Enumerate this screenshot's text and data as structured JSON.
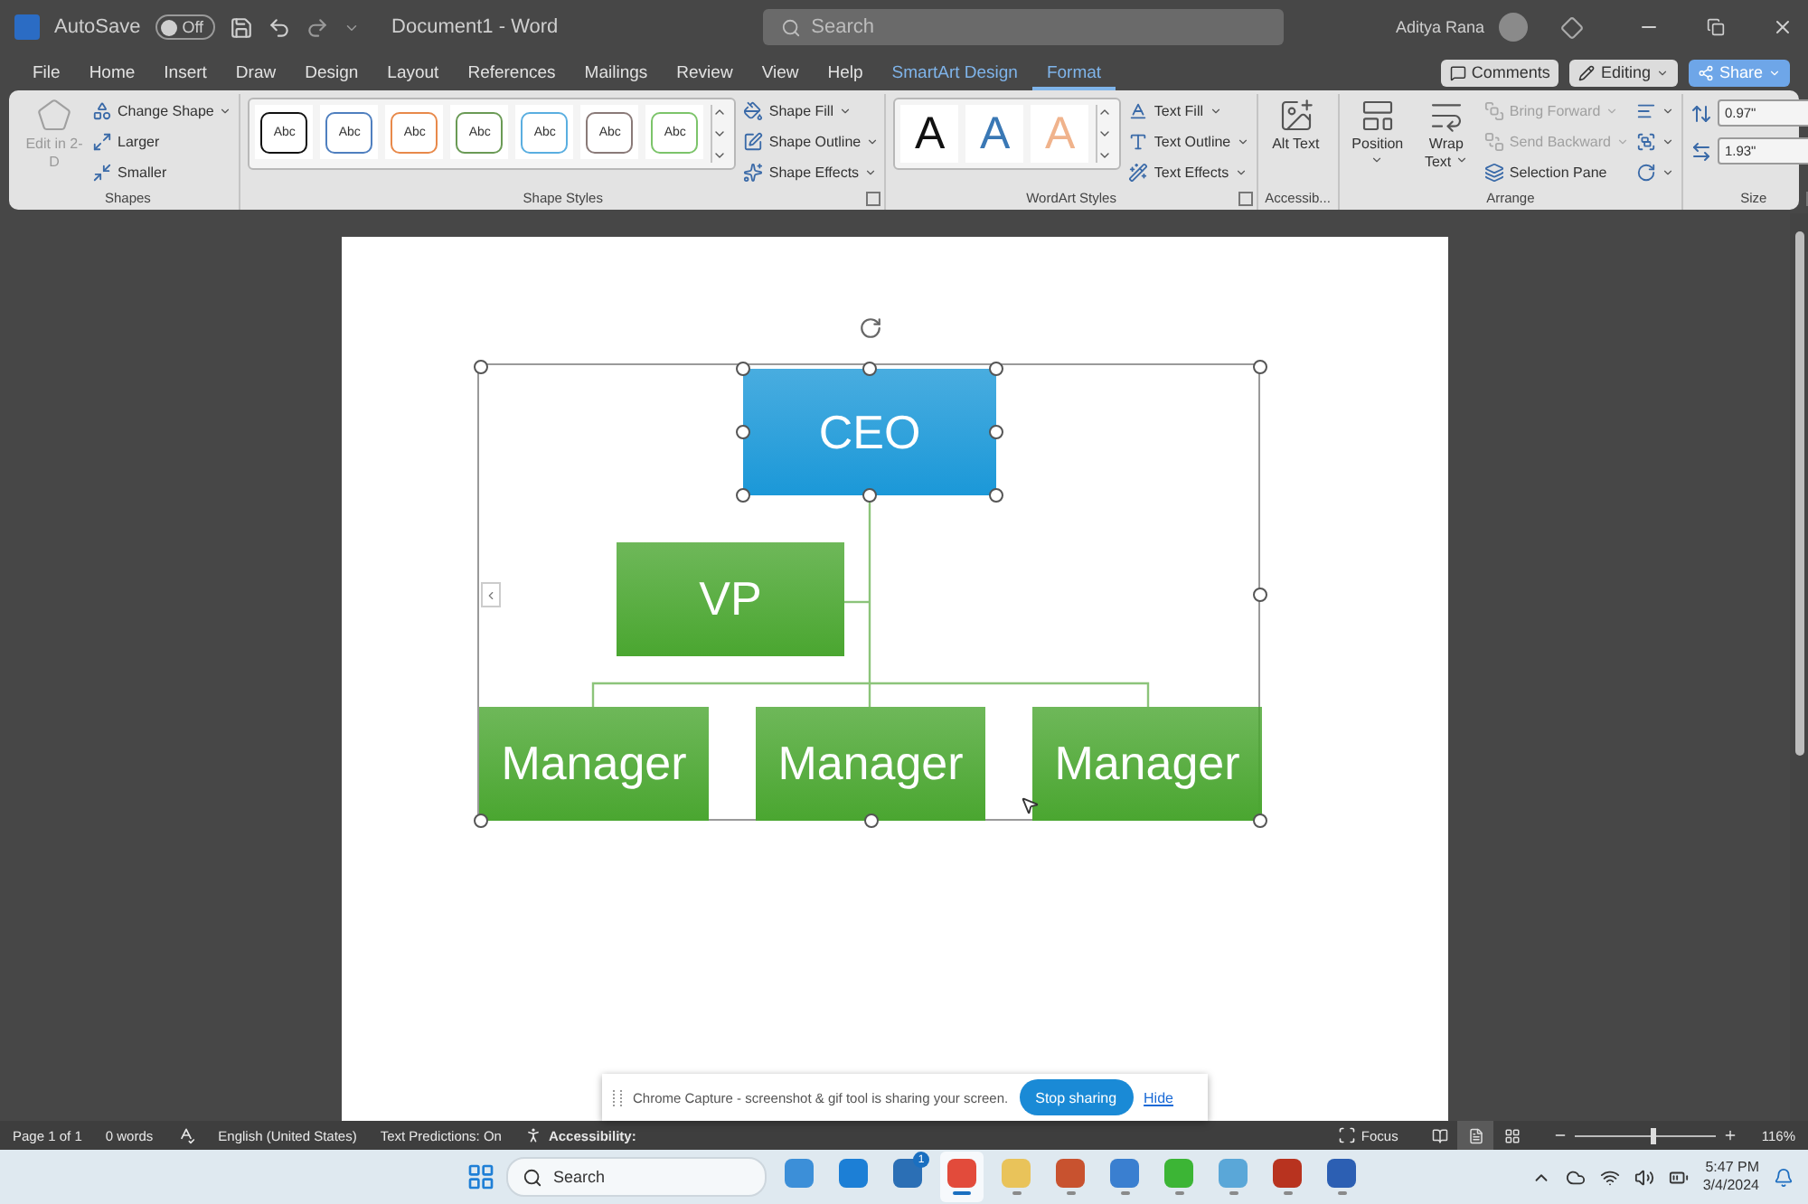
{
  "title_bar": {
    "autosave": {
      "label": "AutoSave",
      "toggle_label": "Off",
      "on": false
    },
    "document_title": "Document1  -  Word",
    "search": {
      "placeholder": "Search"
    },
    "user_name": "Aditya Rana"
  },
  "menu_tabs": [
    {
      "label": "File",
      "selected": false,
      "contextual": false
    },
    {
      "label": "Home",
      "selected": false,
      "contextual": false
    },
    {
      "label": "Insert",
      "selected": false,
      "contextual": false
    },
    {
      "label": "Draw",
      "selected": false,
      "contextual": false
    },
    {
      "label": "Design",
      "selected": false,
      "contextual": false
    },
    {
      "label": "Layout",
      "selected": false,
      "contextual": false
    },
    {
      "label": "References",
      "selected": false,
      "contextual": false
    },
    {
      "label": "Mailings",
      "selected": false,
      "contextual": false
    },
    {
      "label": "Review",
      "selected": false,
      "contextual": false
    },
    {
      "label": "View",
      "selected": false,
      "contextual": false
    },
    {
      "label": "Help",
      "selected": false,
      "contextual": false
    },
    {
      "label": "SmartArt Design",
      "selected": false,
      "contextual": true
    },
    {
      "label": "Format",
      "selected": true,
      "contextual": true
    }
  ],
  "header_buttons": [
    {
      "label": "Comments",
      "kind": "plain",
      "dropdown": false
    },
    {
      "label": "Editing",
      "kind": "plain",
      "dropdown": true
    },
    {
      "label": "Share",
      "kind": "accent",
      "dropdown": true
    }
  ],
  "ribbon": {
    "groups": [
      {
        "label": "Shapes",
        "launcher": false,
        "items": [
          {
            "kind": "large",
            "label": "Edit in 2-D",
            "dropdown": false,
            "disabled": true
          },
          {
            "kind": "stack",
            "buttons": [
              {
                "label": "Change Shape",
                "dropdown": true,
                "disabled": false
              },
              {
                "label": "Larger",
                "dropdown": false,
                "disabled": false
              },
              {
                "label": "Smaller",
                "dropdown": false,
                "disabled": false
              }
            ]
          }
        ]
      },
      {
        "label": "Shape Styles",
        "launcher": true,
        "items": [
          {
            "kind": "gallery",
            "tiles": [
              {
                "label": "Abc",
                "color": "#111111"
              },
              {
                "label": "Abc",
                "color": "#4f7fbf"
              },
              {
                "label": "Abc",
                "color": "#e8894a"
              },
              {
                "label": "Abc",
                "color": "#6a9a55"
              },
              {
                "label": "Abc",
                "color": "#5aaee0"
              },
              {
                "label": "Abc",
                "color": "#8a7a78"
              },
              {
                "label": "Abc",
                "color": "#7cc46a"
              }
            ]
          },
          {
            "kind": "stack",
            "buttons": [
              {
                "label": "Shape Fill",
                "dropdown": true,
                "disabled": false
              },
              {
                "label": "Shape Outline",
                "dropdown": true,
                "disabled": false
              },
              {
                "label": "Shape Effects",
                "dropdown": true,
                "disabled": false
              }
            ]
          }
        ]
      },
      {
        "label": "WordArt Styles",
        "launcher": true,
        "items": [
          {
            "kind": "wordart",
            "tiles": [
              {
                "label": "A",
                "color": "#111111"
              },
              {
                "label": "A",
                "color": "#3a78b5"
              },
              {
                "label": "A",
                "color": "#f0b38c"
              }
            ]
          },
          {
            "kind": "stack",
            "buttons": [
              {
                "label": "Text Fill",
                "dropdown": true,
                "disabled": false
              },
              {
                "label": "Text Outline",
                "dropdown": true,
                "disabled": false
              },
              {
                "label": "Text Effects",
                "dropdown": true,
                "disabled": false
              }
            ]
          }
        ]
      },
      {
        "label": "Accessib...",
        "launcher": false,
        "items": [
          {
            "kind": "large",
            "label": "Alt Text",
            "dropdown": false,
            "disabled": false
          }
        ]
      },
      {
        "label": "Arrange",
        "launcher": false,
        "items": [
          {
            "kind": "large",
            "label": "Position",
            "dropdown": true,
            "disabled": false
          },
          {
            "kind": "large",
            "label": "Wrap Text",
            "dropdown": true,
            "disabled": false
          },
          {
            "kind": "stack",
            "buttons": [
              {
                "label": "Bring Forward",
                "dropdown": true,
                "disabled": true
              },
              {
                "label": "Send Backward",
                "dropdown": true,
                "disabled": true
              },
              {
                "label": "Selection Pane",
                "dropdown": false,
                "disabled": false
              }
            ]
          },
          {
            "kind": "icon_stack",
            "buttons": [
              {
                "dropdown": true
              },
              {
                "dropdown": true
              },
              {
                "dropdown": true
              }
            ]
          }
        ]
      },
      {
        "label": "Size",
        "launcher": true,
        "items": [
          {
            "kind": "spinners",
            "fields": [
              {
                "value": "0.97\""
              },
              {
                "value": "1.93\""
              }
            ]
          }
        ]
      }
    ]
  },
  "document": {
    "smartart": {
      "nodes": [
        {
          "label": "CEO",
          "kind": "top",
          "color": "#1b98d8",
          "selected": true
        },
        {
          "label": "VP",
          "kind": "assistant",
          "color": "#4aa630",
          "selected": false
        },
        {
          "label": "Manager",
          "kind": "report",
          "color": "#4aa630",
          "selected": false
        },
        {
          "label": "Manager",
          "kind": "report",
          "color": "#4aa630",
          "selected": false
        },
        {
          "label": "Manager",
          "kind": "report",
          "color": "#4aa630",
          "selected": false
        }
      ]
    }
  },
  "capture_bar": {
    "message": "Chrome Capture - screenshot & gif tool is sharing your screen.",
    "stop_button": "Stop sharing",
    "hide_link": "Hide"
  },
  "status_bar": {
    "items": [
      {
        "kind": "text",
        "label": "Page 1 of 1"
      },
      {
        "kind": "text",
        "label": "0 words"
      },
      {
        "kind": "proofing"
      },
      {
        "kind": "text",
        "label": "English (United States)"
      },
      {
        "kind": "text",
        "label": "Text Predictions: On"
      },
      {
        "kind": "accessibility",
        "label": "Accessibility:"
      }
    ],
    "focus": {
      "label": "Focus"
    },
    "views": [
      {
        "selected": false
      },
      {
        "selected": true
      },
      {
        "selected": false
      }
    ],
    "zoom": {
      "level": 0.55,
      "reading": "116%"
    }
  },
  "taskbar": {
    "search": {
      "placeholder": "Search"
    },
    "apps": [
      {
        "color": "#3c8fd8",
        "running": false,
        "selected": false
      },
      {
        "color": "#1c7fd6",
        "running": false,
        "selected": false
      },
      {
        "color": "#2b6fb5",
        "running": false,
        "selected": false,
        "badge": "1"
      },
      {
        "color": "#e24b3b",
        "running": true,
        "selected": true
      },
      {
        "color": "#e9c35a",
        "running": true,
        "selected": false
      },
      {
        "color": "#c8522f",
        "running": true,
        "selected": false
      },
      {
        "color": "#3a7fd0",
        "running": true,
        "selected": false
      },
      {
        "color": "#3cb535",
        "running": true,
        "selected": false
      },
      {
        "color": "#5aa7d8",
        "running": true,
        "selected": false
      },
      {
        "color": "#b8331f",
        "running": true,
        "selected": false
      },
      {
        "color": "#2c5fb3",
        "running": true,
        "selected": false
      }
    ],
    "tray": {
      "time": "5:47 PM",
      "date": "3/4/2024"
    }
  }
}
